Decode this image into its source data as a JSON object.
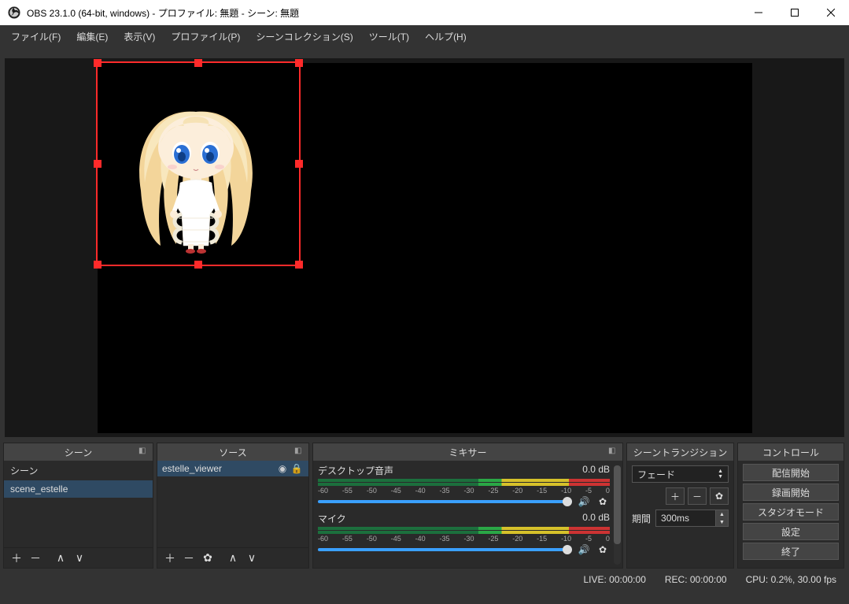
{
  "window": {
    "title": "OBS 23.1.0 (64-bit, windows) - プロファイル: 無題 - シーン: 無題"
  },
  "menubar": {
    "file": "ファイル(F)",
    "edit": "編集(E)",
    "view": "表示(V)",
    "profile": "プロファイル(P)",
    "scene_collection": "シーンコレクション(S)",
    "tools": "ツール(T)",
    "help": "ヘルプ(H)"
  },
  "docks": {
    "scenes": {
      "title": "シーン",
      "header_item": "シーン",
      "items": [
        "scene_estelle"
      ]
    },
    "sources": {
      "title": "ソース",
      "items": [
        {
          "name": "estelle_viewer",
          "visible": true,
          "locked": true
        }
      ]
    },
    "mixer": {
      "title": "ミキサー",
      "ticks": [
        "-60",
        "-55",
        "-50",
        "-45",
        "-40",
        "-35",
        "-30",
        "-25",
        "-20",
        "-15",
        "-10",
        "-5",
        "0"
      ],
      "channels": [
        {
          "name": "デスクトップ音声",
          "db": "0.0 dB"
        },
        {
          "name": "マイク",
          "db": "0.0 dB"
        }
      ]
    },
    "transitions": {
      "title": "シーントランジション",
      "selected": "フェード",
      "duration_label": "期間",
      "duration_value": "300ms"
    },
    "controls": {
      "title": "コントロール",
      "start_stream": "配信開始",
      "start_record": "録画開始",
      "studio_mode": "スタジオモード",
      "settings": "設定",
      "exit": "終了"
    }
  },
  "statusbar": {
    "live": "LIVE: 00:00:00",
    "rec": "REC: 00:00:00",
    "cpu": "CPU: 0.2%, 30.00 fps"
  }
}
